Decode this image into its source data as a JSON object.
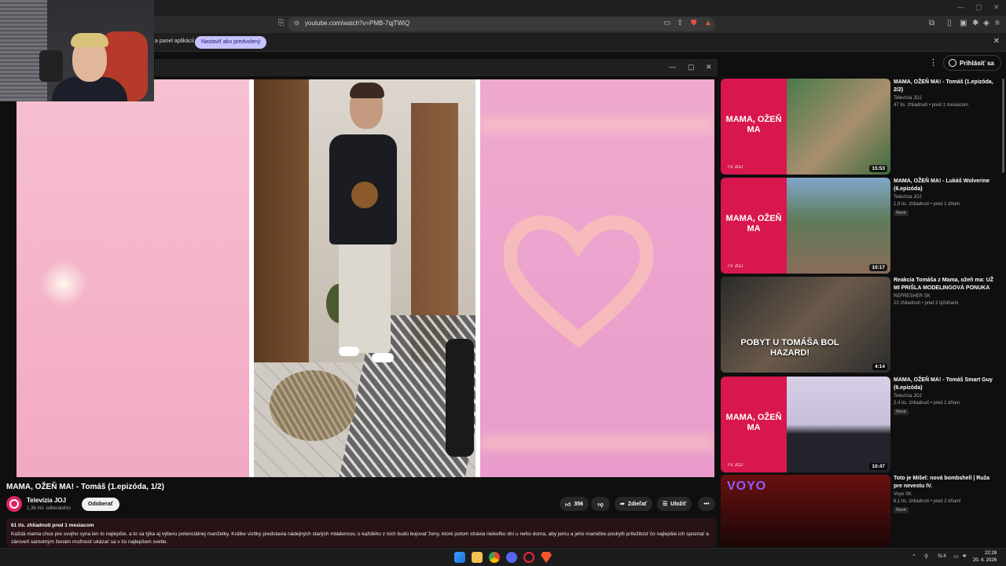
{
  "browser": {
    "url": "youtube.com/watch?v=PMB-7qjTWiQ",
    "infobar_text": "a panel aplikácií",
    "infobar_button": "Nastaviť ako predvolený"
  },
  "youtube": {
    "signin_label": "Prihlásiť sa"
  },
  "video": {
    "title": "MAMA, OŽEŇ MA! - Tomáš (1.epizóda, 1/2)",
    "channel": "Televízia JOJ",
    "subscribers": "1,36 mil. odberateľov",
    "subscribe_label": "Odoberať",
    "likes": "356",
    "share_label": "Zdieľať",
    "save_label": "Uložiť",
    "desc_meta": "61 tis. zhliadnutí  pred 1 mesiacom",
    "desc_body": "Každá mama chce pre svojho syna len to najlepšie, a to sa týka aj výberu potenciálnej manželky. Krátke vizitky predstavia nádejných starých mládencov, o každého z nich budú bojovať ženy, ktoré potom strávia niekoľko dní u neho doma, aby jemu a jeho mamičke poskytli príležitosť čo najlepšie ich spoznať a zároveň samotným ženám možnosť ukázať sa v čo najlepšom svetle."
  },
  "recommendations": [
    {
      "title": "MAMA, OŽEŇ MA! - Tomáš (1.epizóda, 2/2)",
      "channel": "Televízia JOJ",
      "meta": "47 tis. zhliadnutí • pred 1 mesiacom",
      "duration": "15:53",
      "badge": "",
      "thumb_text": "MAMA, OŽEŇ MA",
      "thumb_logo": "TV JOJ"
    },
    {
      "title": "MAMA, OŽEŇ MA! - Lukáš Wolverine (6.epizóda)",
      "channel": "Televízia JOJ",
      "meta": "1,9 tis. zhliadnutí • pred 1 dňom",
      "duration": "10:17",
      "badge": "Nové",
      "thumb_text": "MAMA, OŽEŇ MA",
      "thumb_logo": "TV JOJ"
    },
    {
      "title": "Reakcia Tomáša z Mama, ožeň ma: UŽ MI PRIŠLA MODELINGOVÁ PONUKA",
      "channel": "REFRESHER SK",
      "meta": "22 zhliadnutí • pred 3 týždňami",
      "duration": "4:14",
      "badge": "",
      "thumb_text": "POBYT U TOMÁŠA BOL HAZARD!",
      "thumb_logo": ""
    },
    {
      "title": "MAMA, OŽEŇ MA! - Tomáš Smart Guy (6.epizóda)",
      "channel": "Televízia JOJ",
      "meta": "2,4 tis. zhliadnutí • pred 1 dňom",
      "duration": "10:47",
      "badge": "Nové",
      "thumb_text": "MAMA, OŽEŇ MA",
      "thumb_logo": "TV JOJ"
    },
    {
      "title": "Toto je Mišel: nová bombshell | Ruža pre nevestu IV.",
      "channel": "Voyo SK",
      "meta": "6,1 tis. zhliadnutí • pred 2 dňami",
      "duration": "",
      "badge": "Nové",
      "thumb_text": "VOYO",
      "thumb_logo": ""
    }
  ],
  "taskbar": {
    "lang": "SLK",
    "time": "22:28",
    "date": "20. 4. 2026"
  },
  "colors": {
    "accent_pill": "#c6c2ff",
    "joj_red": "#d8174f",
    "desc_bg": "#271316"
  }
}
